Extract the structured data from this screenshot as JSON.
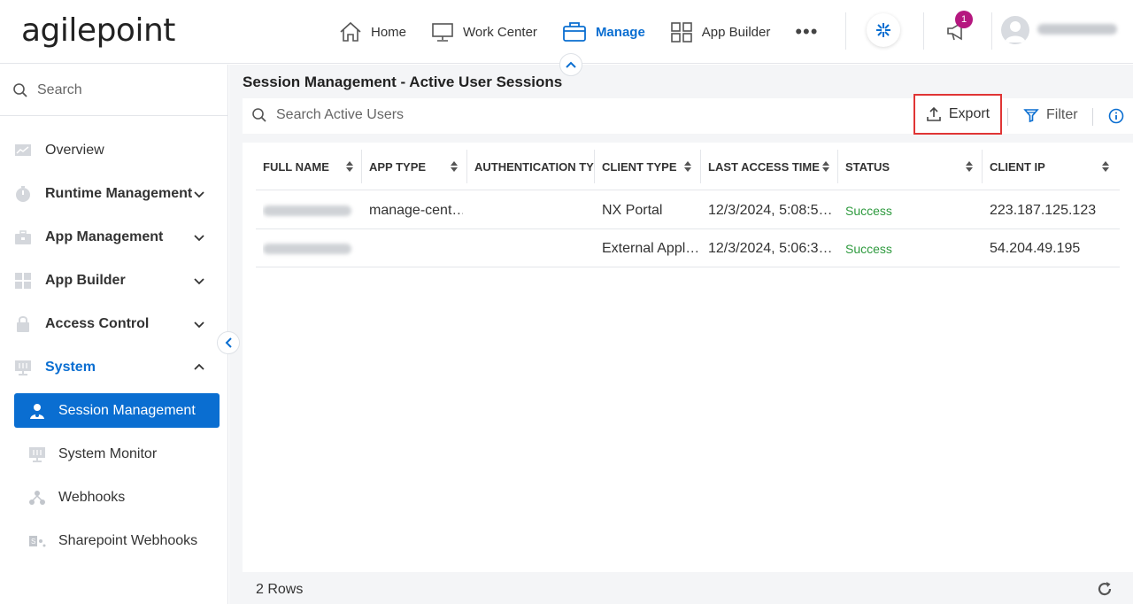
{
  "header": {
    "logo": "agilepoint",
    "nav": [
      {
        "label": "Home",
        "icon": "home-icon",
        "active": false
      },
      {
        "label": "Work Center",
        "icon": "monitor-icon",
        "active": false
      },
      {
        "label": "Manage",
        "icon": "briefcase-icon",
        "active": true
      },
      {
        "label": "App Builder",
        "icon": "grid-icon",
        "active": false
      }
    ],
    "more": "•••",
    "notification_count": "1"
  },
  "sidebar": {
    "search_placeholder": "Search",
    "items": [
      {
        "label": "Overview",
        "icon": "chart-icon"
      },
      {
        "label": "Runtime Management",
        "icon": "timer-icon"
      },
      {
        "label": "App Management",
        "icon": "toolbox-icon"
      },
      {
        "label": "App Builder",
        "icon": "grid-icon"
      },
      {
        "label": "Access Control",
        "icon": "lock-icon"
      },
      {
        "label": "System",
        "icon": "monitor-settings-icon"
      }
    ],
    "system_children": [
      {
        "label": "Session Management",
        "icon": "user-session-icon",
        "active": true
      },
      {
        "label": "System Monitor",
        "icon": "monitor-settings-icon",
        "active": false
      },
      {
        "label": "Webhooks",
        "icon": "webhook-icon",
        "active": false
      },
      {
        "label": "Sharepoint Webhooks",
        "icon": "sharepoint-icon",
        "active": false
      }
    ]
  },
  "main": {
    "title": "Session Management - Active User Sessions",
    "search_placeholder": "Search Active Users",
    "export_label": "Export",
    "filter_label": "Filter",
    "columns": [
      "FULL NAME",
      "APP TYPE",
      "AUTHENTICATION TYPE",
      "CLIENT TYPE",
      "LAST ACCESS TIME",
      "STATUS",
      "CLIENT IP"
    ],
    "rows": [
      {
        "full_name": "",
        "app_type": "manage-cent…",
        "auth_type": "",
        "client_type": "NX Portal",
        "last_access": "12/3/2024, 5:08:5…",
        "status": "Success",
        "client_ip": "223.187.125.123"
      },
      {
        "full_name": "",
        "app_type": "",
        "auth_type": "",
        "client_type": "External Appl…",
        "last_access": "12/3/2024, 5:06:3…",
        "status": "Success",
        "client_ip": "54.204.49.195"
      }
    ],
    "rows_count": "2 Rows"
  },
  "colors": {
    "accent": "#0a6ed1",
    "success": "#2e9a3e",
    "highlight_border": "#e03535",
    "badge": "#b5177f"
  }
}
